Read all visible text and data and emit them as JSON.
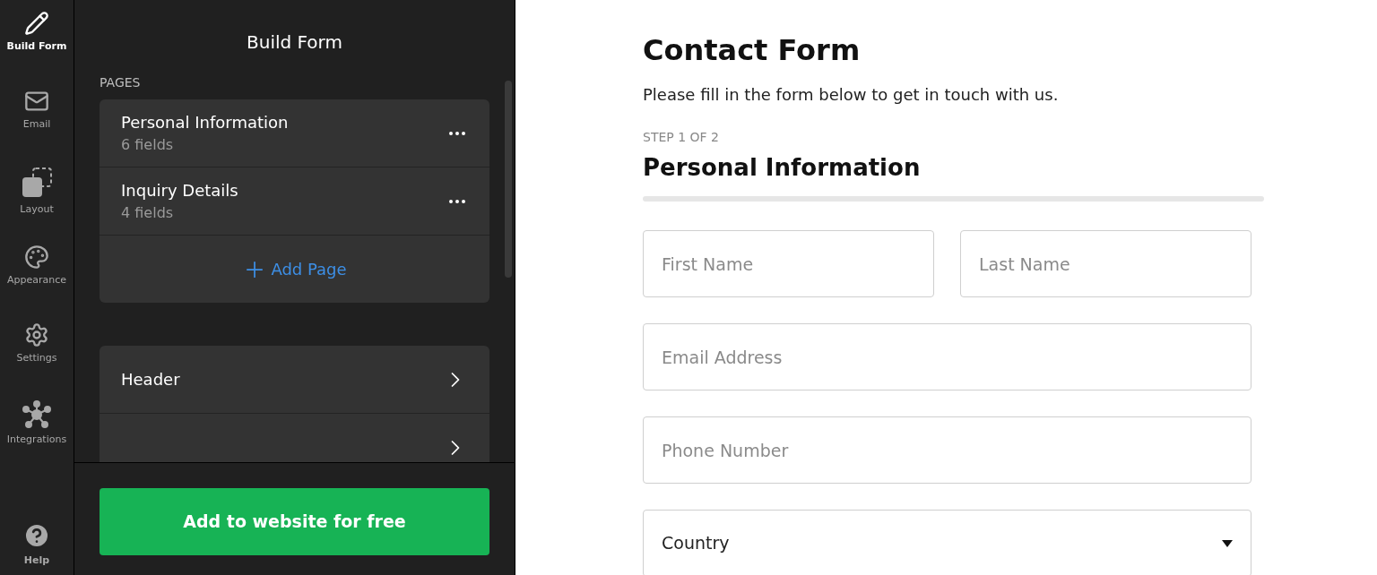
{
  "rail": [
    {
      "label": "Build Form",
      "kind": "pencil",
      "selected": true
    },
    {
      "label": "Email",
      "kind": "mail",
      "selected": false
    },
    {
      "label": "Layout",
      "kind": "layout",
      "selected": false
    },
    {
      "label": "Appearance",
      "kind": "palette",
      "selected": false
    },
    {
      "label": "Settings",
      "kind": "gear",
      "selected": false
    },
    {
      "label": "Integrations",
      "kind": "network",
      "selected": false
    }
  ],
  "help": {
    "label": "Help"
  },
  "panel": {
    "title": "Build Form",
    "pages_heading": "PAGES",
    "pages": [
      {
        "name": "Personal Information",
        "count": "6 fields"
      },
      {
        "name": "Inquiry Details",
        "count": "4 fields"
      }
    ],
    "add_page": "Add Page",
    "sections": [
      {
        "kind": "link",
        "label": "Header"
      },
      {
        "kind": "link"
      }
    ],
    "cta": "Add to website for free"
  },
  "form": {
    "title": "Contact Form",
    "subtitle": "Please fill in the form below to get in touch with us.",
    "step": "STEP 1 OF 2",
    "section": "Personal Information",
    "rows": [
      [
        {
          "kind": "text",
          "placeholder": "First Name"
        },
        {
          "kind": "text",
          "placeholder": "Last Name"
        }
      ],
      [
        {
          "kind": "text",
          "placeholder": "Email Address"
        }
      ],
      [
        {
          "kind": "text",
          "placeholder": "Phone Number"
        }
      ],
      [
        {
          "kind": "select",
          "value": "Country"
        }
      ]
    ]
  }
}
